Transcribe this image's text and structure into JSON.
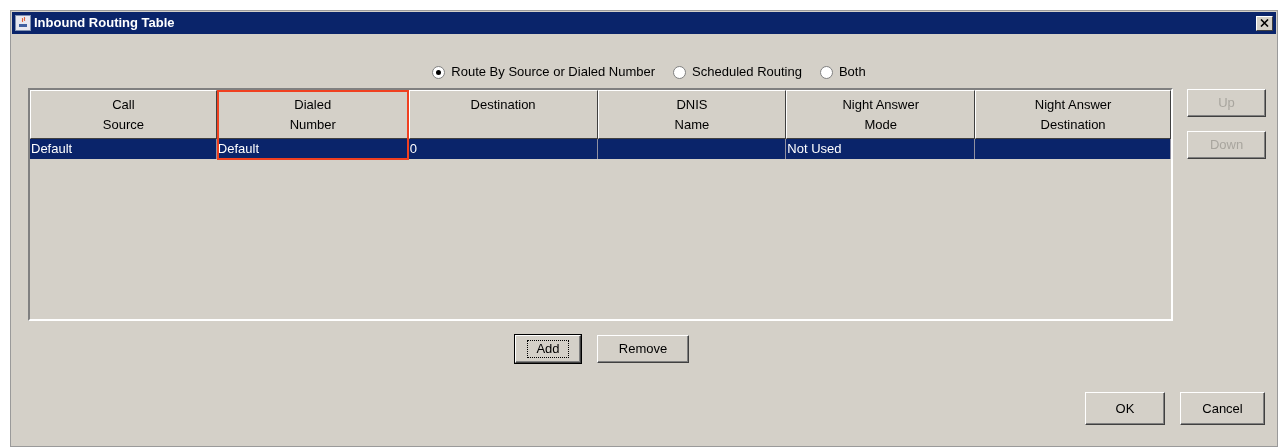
{
  "window": {
    "title": "Inbound Routing Table"
  },
  "routing_modes": [
    {
      "label": "Route By Source or Dialed Number",
      "selected": true
    },
    {
      "label": "Scheduled Routing",
      "selected": false
    },
    {
      "label": "Both",
      "selected": false
    }
  ],
  "table": {
    "columns": [
      {
        "lines": [
          "Call",
          "Source"
        ],
        "highlighted": false
      },
      {
        "lines": [
          "Dialed",
          "Number"
        ],
        "highlighted": true
      },
      {
        "lines": [
          "Destination"
        ],
        "highlighted": false
      },
      {
        "lines": [
          "DNIS",
          "Name"
        ],
        "highlighted": false
      },
      {
        "lines": [
          "Night Answer",
          "Mode"
        ],
        "highlighted": false
      },
      {
        "lines": [
          "Night Answer",
          "Destination"
        ],
        "highlighted": false
      }
    ],
    "rows": [
      {
        "selected": true,
        "cells": [
          "Default",
          "Default",
          "0",
          "",
          "Not Used",
          ""
        ]
      }
    ]
  },
  "side_buttons": [
    {
      "label": "Up",
      "disabled": true
    },
    {
      "label": "Down",
      "disabled": true
    }
  ],
  "table_buttons": [
    {
      "label": "Add",
      "focused": true
    },
    {
      "label": "Remove",
      "focused": false
    }
  ],
  "dialog_buttons": [
    {
      "label": "OK"
    },
    {
      "label": "Cancel"
    }
  ]
}
